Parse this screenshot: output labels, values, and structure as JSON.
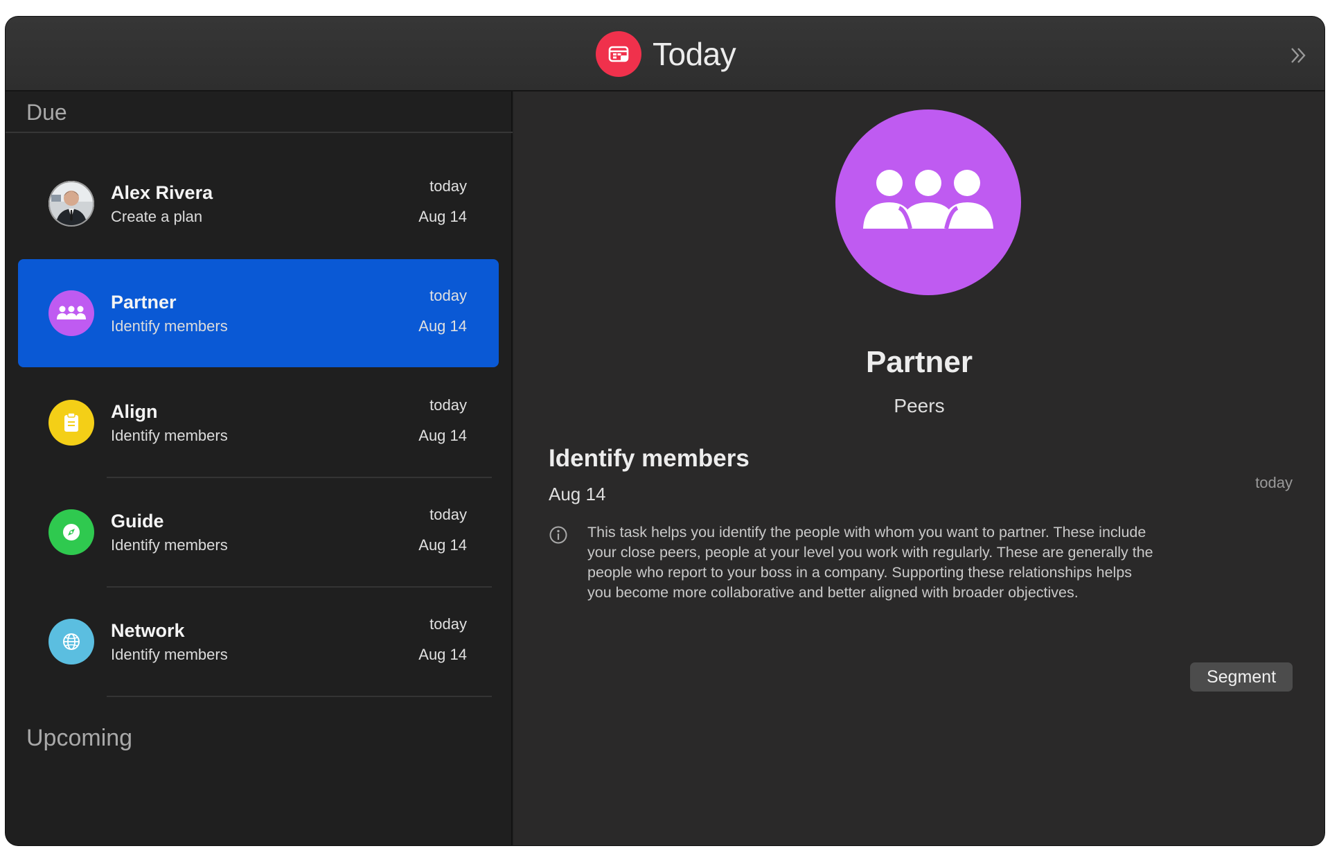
{
  "window": {
    "title": "Today",
    "app_icon": "calendar-card-icon"
  },
  "toolbar": {
    "expand_icon": "chevron-double-right-icon"
  },
  "colors": {
    "accent_selected": "#0a59d5",
    "app_icon": "#f0314c",
    "partner": "#bf5bf1",
    "align": "#f4cf17",
    "guide": "#2fc94f",
    "network": "#5bbee0"
  },
  "sidebar": {
    "due_label": "Due",
    "upcoming_label": "Upcoming",
    "tasks": [
      {
        "name": "Alex Rivera",
        "subtitle": "Create a plan",
        "day": "today",
        "date": "Aug 14",
        "icon": "person-photo-avatar"
      },
      {
        "name": "Partner",
        "subtitle": "Identify members",
        "day": "today",
        "date": "Aug 14",
        "icon": "group-icon"
      },
      {
        "name": "Align",
        "subtitle": "Identify members",
        "day": "today",
        "date": "Aug 14",
        "icon": "clipboard-icon"
      },
      {
        "name": "Guide",
        "subtitle": "Identify members",
        "day": "today",
        "date": "Aug 14",
        "icon": "compass-icon"
      },
      {
        "name": "Network",
        "subtitle": "Identify members",
        "day": "today",
        "date": "Aug 14",
        "icon": "globe-icon"
      }
    ]
  },
  "detail": {
    "icon": "group-icon",
    "title": "Partner",
    "subtitle": "Peers",
    "step_title": "Identify members",
    "step_date": "Aug 14",
    "step_day": "today",
    "description": "This task helps you identify the people with whom you want to partner. These include your close peers, people at your level you work with regularly. These are generally the people who report to your boss in a company. Supporting these relationships helps you become more collaborative and better aligned with broader objectives.",
    "segment_label": "Segment"
  }
}
